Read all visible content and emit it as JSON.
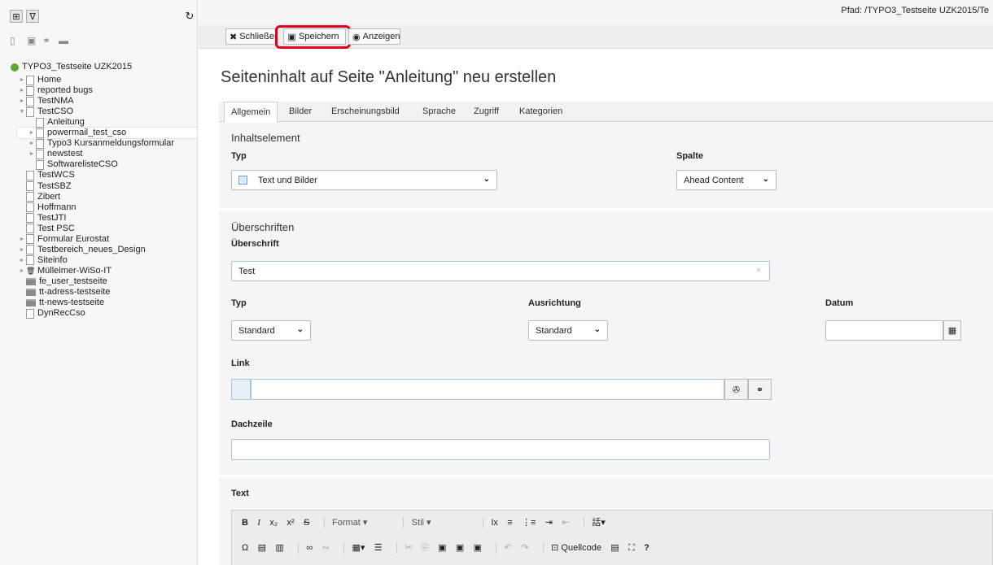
{
  "topbar": {
    "path": "Pfad: /TYPO3_Testseite UZK2015/Te"
  },
  "toolbar": {
    "close_label": "Schließen",
    "save_label": "Speichern",
    "view_label": "Anzeigen"
  },
  "tree": {
    "root": "TYPO3_Testseite UZK2015",
    "items": [
      "Home",
      "reported bugs",
      "TestNMA",
      "TestCSO",
      "Anleitung",
      "powermail_test_cso",
      "Typo3 Kursanmeldungsformular",
      "newstest",
      "SoftwarelisteCSO",
      "TestWCS",
      "TestSBZ",
      "Zibert",
      "Hoffmann",
      "TestJTI",
      "Test PSC",
      "Formular Eurostat",
      "Testbereich_neues_Design",
      "Siteinfo",
      "Mülleimer-WiSo-IT",
      "fe_user_testseite",
      "tt-adress-testseite",
      "tt-news-testseite",
      "DynRecCso"
    ]
  },
  "page": {
    "title": "Seiteninhalt auf Seite \"Anleitung\" neu erstellen"
  },
  "tabs": [
    "Allgemein",
    "Bilder",
    "Erscheinungsbild",
    "Sprache",
    "Zugriff",
    "Kategorien"
  ],
  "form": {
    "section1": "Inhaltselement",
    "typ_label": "Typ",
    "typ_value": "Text und Bilder",
    "spalte_label": "Spalte",
    "spalte_value": "Ahead Content",
    "section2": "Überschriften",
    "ueberschrift_label": "Überschrift",
    "ueberschrift_value": "Test",
    "typ2_label": "Typ",
    "typ2_value": "Standard",
    "ausrichtung_label": "Ausrichtung",
    "ausrichtung_value": "Standard",
    "datum_label": "Datum",
    "link_label": "Link",
    "dachzeile_label": "Dachzeile",
    "text_label": "Text"
  },
  "rte": {
    "format": "Format",
    "stil": "Stil",
    "quellcode": "Quellcode"
  },
  "colors": {
    "highlight": "#e2001a",
    "accent": "#5b9bd5"
  }
}
